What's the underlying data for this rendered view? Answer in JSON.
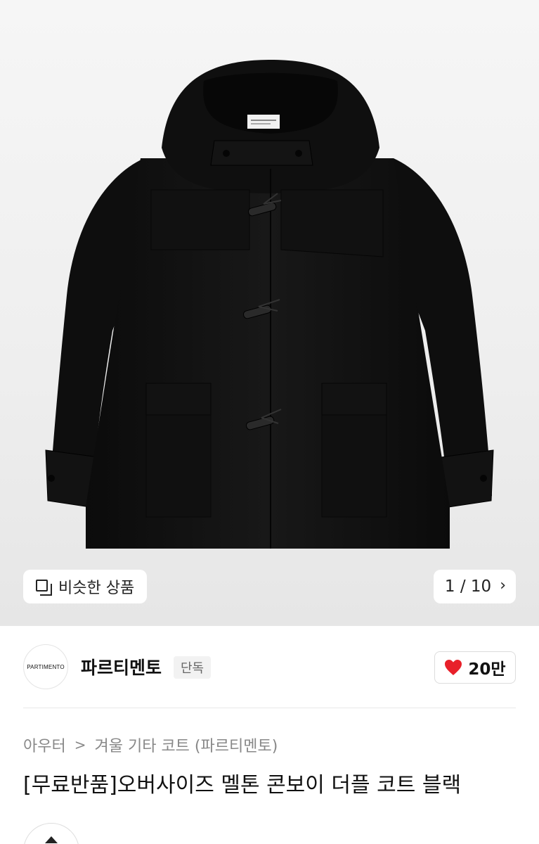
{
  "image": {
    "similar_label": "비슷한 상품",
    "counter": "1 / 10",
    "similar_icon": "similar-items-icon",
    "counter_icon": "chevron-right-icon"
  },
  "brand": {
    "logo_text": "PARTIMENTO",
    "name": "파르티멘토",
    "tag": "단독",
    "like_count": "20만",
    "heart_color": "#e8202a"
  },
  "breadcrumb": {
    "level1": "아우터",
    "separator": ">",
    "level2": "겨울 기타 코트 (파르티멘토)"
  },
  "product": {
    "title": "[무료반품]오버사이즈 멜톤 콘보이 더플 코트 블랙"
  }
}
